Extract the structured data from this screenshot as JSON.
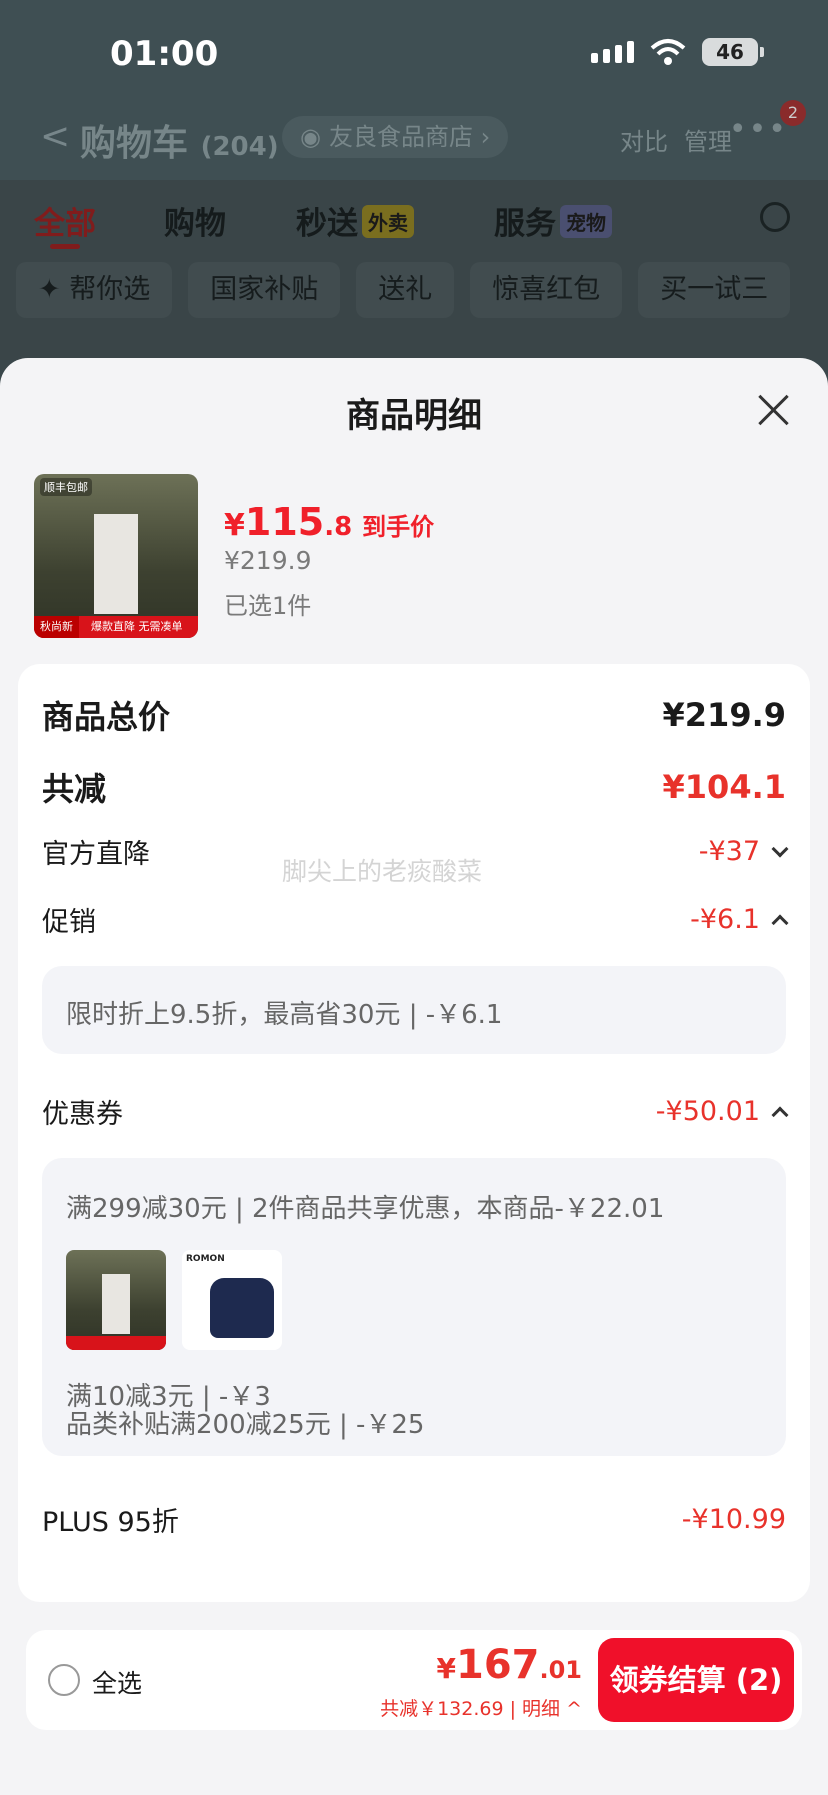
{
  "status": {
    "time": "01:00",
    "battery": "46"
  },
  "background": {
    "cart_title": "购物车",
    "cart_count": "(204)",
    "store_name": "友良食品商店",
    "compare": "对比",
    "manage": "管理",
    "more": "•••",
    "notif": "2",
    "tabs": [
      {
        "label": "全部"
      },
      {
        "label": "购物"
      },
      {
        "label": "秒送",
        "tag": "外卖"
      },
      {
        "label": "服务",
        "tag": "宠物"
      }
    ],
    "chips": [
      "帮你选",
      "国家补贴",
      "送礼",
      "惊喜红包",
      "买一试三"
    ]
  },
  "sheet": {
    "title": "商品明细",
    "product": {
      "price_yen": "¥",
      "price_int": "115",
      "price_dec": ".8",
      "price_label": "到手价",
      "original": "¥219.9",
      "selected": "已选1件",
      "img_badge": "顺丰包邮",
      "img_brand": "秋尚新",
      "img_strip": "爆款直降 无需凑单"
    },
    "summary": {
      "total_label": "商品总价",
      "total_value": "¥219.9",
      "reduce_label": "共减",
      "reduce_value": "¥104.1",
      "official_label": "官方直降",
      "official_value": "-¥37",
      "promo_label": "促销",
      "promo_value": "-¥6.1",
      "promo_detail": "限时折上9.5折，最高省30元 | -￥6.1",
      "coupon_label": "优惠券",
      "coupon_value": "-¥50.01",
      "coupon_lines": [
        "满299减30元 | 2件商品共享优惠，本商品-￥22.01",
        "满10减3元 | -￥3",
        "品类补贴满200减25元 | -￥25"
      ],
      "sweater_brand": "ROMON",
      "plus_label": "PLUS 95折",
      "plus_value": "-¥10.99",
      "watermark": "脚尖上的老痰酸菜"
    }
  },
  "checkout": {
    "select_all": "全选",
    "total_yen": "¥",
    "total_int": "167",
    "total_dec": ".01",
    "reduce_text": "共减￥132.69 | 明细 ^",
    "button": "领券结算 (2)"
  }
}
